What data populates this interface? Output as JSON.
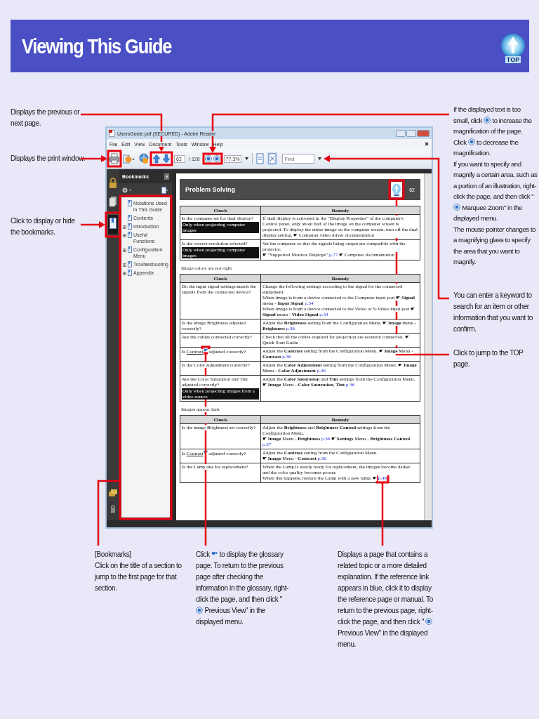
{
  "header": {
    "title": "Viewing This Guide",
    "top_label": "TOP"
  },
  "annotations": [
    {
      "paragraphs": [
        [
          {
            "kind": "text",
            "text": "Displays the previous or next page."
          }
        ]
      ]
    },
    {
      "paragraphs": [
        [
          {
            "kind": "text",
            "text": "Displays the print window."
          }
        ]
      ]
    },
    {
      "paragraphs": [
        [
          {
            "kind": "text",
            "text": "Click to display or hide the bookmarks."
          }
        ]
      ]
    },
    {
      "paragraphs": [
        [
          {
            "kind": "text",
            "text": "If the displayed text is too small, click"
          },
          {
            "kind": "icon"
          },
          {
            "kind": "text",
            "text": "to increase the magnification of the page."
          }
        ],
        [
          {
            "kind": "text",
            "text": "Click"
          },
          {
            "kind": "icon"
          },
          {
            "kind": "text",
            "text": "to decrease the magnification."
          }
        ],
        [
          {
            "kind": "text",
            "text": "If you want to specify and magnify a certain area, such as a portion of an illustration, right-click the page, and then click \""
          },
          {
            "kind": "icon"
          },
          {
            "kind": "text",
            "text": "Marquee Zoom\" in the displayed menu."
          }
        ],
        [
          {
            "kind": "text",
            "text": "The mouse pointer changes to a magnifying glass to specify the area that you want to magnify."
          }
        ]
      ]
    },
    {
      "paragraphs": [
        [
          {
            "kind": "text",
            "text": "You can enter a keyword to search for an item or other information that you want to confirm."
          }
        ]
      ]
    },
    {
      "paragraphs": [
        [
          {
            "kind": "text",
            "text": "Click to jump to the TOP page."
          }
        ]
      ]
    },
    {
      "paragraphs": [
        [
          {
            "kind": "text",
            "text": "[Bookmarks]"
          }
        ],
        [
          {
            "kind": "text",
            "text": "Click on the title of a section to jump to the first page for that section."
          }
        ]
      ]
    },
    {
      "paragraphs": [
        [
          {
            "kind": "text",
            "text": "Click"
          },
          {
            "kind": "glossary"
          },
          {
            "kind": "text",
            "text": "to display the glossary page. To return to the previous page after checking the information in the glossary, right-click the page, and then click \""
          },
          {
            "kind": "icon"
          },
          {
            "kind": "text",
            "text": "Previous View\" in the displayed menu."
          }
        ]
      ]
    },
    {
      "paragraphs": [
        [
          {
            "kind": "text",
            "text": "Displays a page that contains a related topic or a more detailed explanation. If the reference link appears in blue, click it to display the reference page or manual. To return to the previous page, right-click the page, and then click \""
          },
          {
            "kind": "icon"
          },
          {
            "kind": "text",
            "text": "Previous View\" in the displayed menu."
          }
        ]
      ]
    }
  ],
  "reader": {
    "title": "UsersGuide.pdf (SECURED) - Adobe Reader",
    "menus": [
      "File",
      "Edit",
      "View",
      "Document",
      "Tools",
      "Window",
      "Help"
    ],
    "toolbar": {
      "page": "62",
      "page_count": "/ 126",
      "zoom": "77.3%",
      "find_placeholder": "Find"
    },
    "bookmarks": {
      "title": "Bookmarks",
      "items": [
        {
          "label": "Notations Used in This Guide",
          "kind": "leaf"
        },
        {
          "label": "Contents",
          "kind": "leaf"
        },
        {
          "label": "Introduction",
          "kind": "branch"
        },
        {
          "label": "Useful Functions",
          "kind": "branch"
        },
        {
          "label": "Configuration Menu",
          "kind": "branch"
        },
        {
          "label": "Troubleshooting",
          "kind": "branch"
        },
        {
          "label": "Appendix",
          "kind": "branch"
        }
      ]
    },
    "document": {
      "title": "Problem Solving",
      "page_number": "62",
      "sections": [
        {
          "columns": [
            "Check",
            "Remedy"
          ],
          "rows": [
            {
              "check": {
                "text": "Is the computer set for dual display?",
                "badge": "Only when projecting computer images"
              },
              "remedy": [
                {
                  "text": "If dual display is activated in the \"Display Properties\" of the computer's Control panel, only about half of the image on the computer screen is projected. To display the entire image on the computer screen, turn off the dual display setting. ☛ Computer video driver documentation"
                }
              ]
            },
            {
              "check": {
                "text": "Is the correct resolution selected?",
                "badge": "Only when projecting computer images"
              },
              "remedy": [
                {
                  "text": "Set the computer so that the signals being output are compatible with the projector."
                },
                {
                  "text": "☛ \"Supported Monitor Displays\"",
                  "link": "p.77",
                  "after": "☛ Computer documentation"
                }
              ]
            }
          ]
        },
        {
          "heading": "Image colors are not right",
          "columns": [
            "Check",
            "Remedy"
          ],
          "rows": [
            {
              "check": {
                "text": "Do the input signal settings match the signals from the connected device?"
              },
              "remedy": [
                {
                  "text": "Change the following settings according to the signal for the connected equipment."
                },
                {
                  "text": "When image is from a device connected to the Computer input port ☛ **Signal** menu - **Input Signal**",
                  "link": "p.34"
                },
                {
                  "text": "When image is from a device connected to the Video or S-Video input port ☛ **Signal** menu - **Video Signal**",
                  "link": "p.34"
                }
              ]
            },
            {
              "check": {
                "text": "Is the image Brightness adjusted correctly?"
              },
              "remedy": [
                {
                  "text": "Adjust the **Brightness** setting from the Configuration Menu. ☛ **Image** menu - **Brightness**",
                  "link": "p.36"
                }
              ]
            },
            {
              "check": {
                "text": "Are the cables connected correctly?"
              },
              "remedy": [
                {
                  "text": "Check that all the cables required for projection are securely connected. ☛ Quick Start Guide"
                }
              ]
            },
            {
              "check": {
                "text": "Is",
                "term": "Contrast",
                "after": "adjusted correctly?"
              },
              "remedy": [
                {
                  "text": "Adjust the **Contrast** setting from the Configuration Menu. ☛ **Image** Menu - **Contrast**",
                  "link": "p.36"
                }
              ]
            },
            {
              "check": {
                "text": "Is the Color Adjustment correctly?"
              },
              "remedy": [
                {
                  "text": "Adjust the **Color Adjustment** setting from the Configuration Menu. ☛ **Image** Menu - **Color Adjustment**",
                  "link": "p.36"
                }
              ]
            },
            {
              "check": {
                "text": "Are the Color Saturation and Tint adjusted correctly?",
                "badge": "Only when projecting images from a video source"
              },
              "remedy": [
                {
                  "text": "Adjust the **Color Saturation** and **Tint** settings from the Configuration Menu. ☛ **Image** Menu - **Color Saturation**, **Tint**",
                  "link": "p.36"
                }
              ]
            }
          ]
        },
        {
          "heading": "Images appear dark",
          "columns": [
            "Check",
            "Remedy"
          ],
          "rows": [
            {
              "check": {
                "text": "Is the image Brightness set correctly?"
              },
              "remedy": [
                {
                  "text": "Adjust the **Brightness** and **Brightness Control** settings from the Configuration Menu."
                },
                {
                  "text": "☛ **Image** Menu - **Brightness**",
                  "link": "p.36",
                  "after": "☛ **Settings** Menu - **Brightness Control**",
                  "link2": "p.37"
                }
              ]
            },
            {
              "check": {
                "text": "Is",
                "term": "Contrast",
                "after": "adjusted correctly?"
              },
              "remedy": [
                {
                  "text": "Adjust the **Contrast** setting from the Configuration Menu."
                },
                {
                  "text": "☛ **Image** Menu - **Contrast**",
                  "link": "p.36"
                }
              ]
            },
            {
              "check": {
                "text": "Is the Lamp due for replacement?"
              },
              "remedy": [
                {
                  "text": "When the Lamp is nearly ready for replacement, the images become darker and the color quality becomes poorer."
                },
                {
                  "text": "When this happens, replace the Lamp with a new lamp. ☛",
                  "link": "p.48"
                }
              ]
            }
          ]
        }
      ]
    }
  }
}
